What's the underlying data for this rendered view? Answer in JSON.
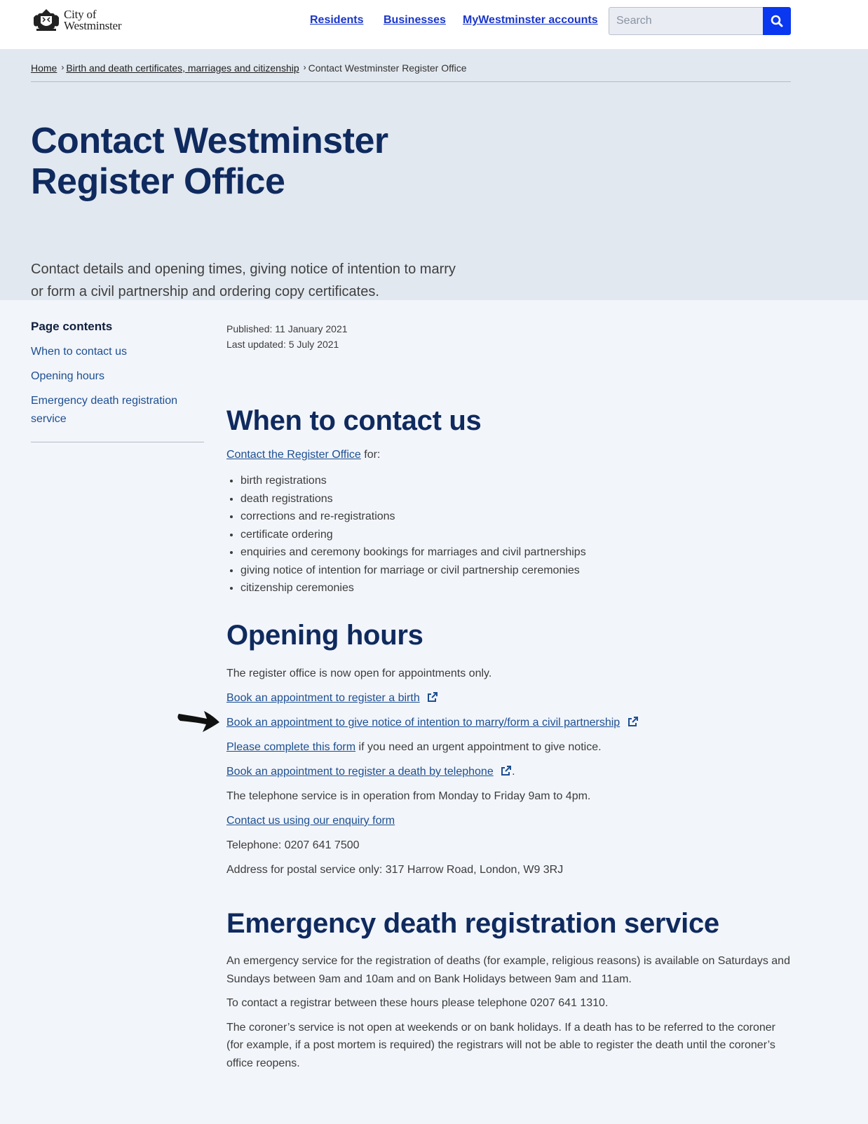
{
  "header": {
    "logo_line1": "City of",
    "logo_line2": "Westminster",
    "nav": [
      "Residents",
      "Businesses",
      "MyWestminster accounts"
    ],
    "search_placeholder": "Search"
  },
  "breadcrumb": {
    "items": [
      "Home",
      "Birth and death certificates, marriages and citizenship"
    ],
    "current": "Contact Westminster Register Office"
  },
  "hero": {
    "title": "Contact Westminster Register Office",
    "lede": "Contact details and opening times, giving notice of intention to marry or form a civil partnership and ordering copy certificates."
  },
  "sidebar": {
    "heading": "Page contents",
    "items": [
      "When to contact us",
      "Opening hours",
      "Emergency death registration service"
    ]
  },
  "meta": {
    "published": "Published: 11 January 2021",
    "updated": "Last updated: 5 July 2021"
  },
  "when": {
    "heading": "When to contact us",
    "contact_link": "Contact the Register Office",
    "contact_suffix": " for:",
    "items": [
      "birth registrations",
      "death registrations",
      "corrections and re-registrations",
      "certificate ordering",
      "enquiries and ceremony bookings for marriages and civil partnerships",
      "giving notice of intention for marriage or civil partnership ceremonies",
      "citizenship ceremonies"
    ]
  },
  "opening": {
    "heading": "Opening hours",
    "intro": "The register office is now open for appointments only.",
    "book_birth": "Book an appointment to register a birth",
    "book_notice": "Book an appointment to give notice of intention to marry/form a civil partnership",
    "form_link": "Please complete this form",
    "form_suffix": " if you need an urgent appointment to give notice.",
    "book_death": "Book an appointment to register a death by telephone",
    "book_death_suffix": ".",
    "phone_hours": "The telephone service is in operation from Monday to Friday 9am to 4pm.",
    "enquiry_link": "Contact us using our enquiry form",
    "telephone": "Telephone: 0207 641 7500",
    "address": "Address for postal service only: 317 Harrow Road, London, W9 3RJ"
  },
  "emergency": {
    "heading": "Emergency death registration service",
    "p1": "An emergency service for the registration of deaths (for example, religious reasons) is available on Saturdays and Sundays between 9am and 10am and on Bank Holidays between 9am and 11am.",
    "p2": "To contact a registrar between these hours please telephone 0207 641 1310.",
    "p3": "The coroner’s service is not open at weekends or on bank holidays. If a death has to be referred to the coroner (for example, if a post mortem is required) the registrars will not be able to register the death until the coroner’s office reopens."
  },
  "colors": {
    "heading": "#0f2a5e",
    "link": "#1d4f91",
    "nav_link": "#1a36c9",
    "search_button": "#0a37f0",
    "hero_bg": "#e2e8f0",
    "page_bg": "#f2f5fa"
  },
  "icons": [
    "city-crest-logo-icon",
    "search-icon",
    "external-link-icon",
    "arrow-annotation-icon"
  ]
}
